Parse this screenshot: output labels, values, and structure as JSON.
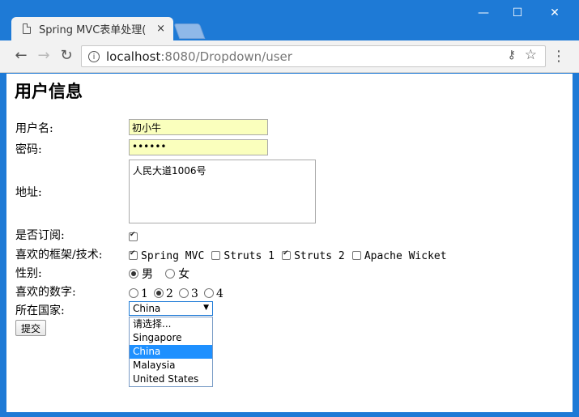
{
  "browser": {
    "tab_title": "Spring MVC表单处理(",
    "tab_close": "×",
    "url_host": "localhost",
    "url_path": ":8080/Dropdown/user",
    "win_minimize": "—",
    "win_maximize": "☐",
    "win_close": "✕"
  },
  "page": {
    "title": "用户信息",
    "username_label": "用户名:",
    "username_value": "初小牛",
    "password_label": "密码:",
    "password_value": "••••••",
    "address_label": "地址:",
    "address_value": "人民大道1006号",
    "subscribe_label": "是否订阅:",
    "subscribe_checked": true,
    "frameworks_label": "喜欢的框架/技术:",
    "frameworks": [
      {
        "label": "Spring MVC",
        "checked": true
      },
      {
        "label": "Struts 1",
        "checked": false
      },
      {
        "label": "Struts 2",
        "checked": true
      },
      {
        "label": "Apache Wicket",
        "checked": false
      }
    ],
    "gender_label": "性别:",
    "genders": [
      {
        "label": "男",
        "checked": true
      },
      {
        "label": "女",
        "checked": false
      }
    ],
    "number_label": "喜欢的数字:",
    "numbers": [
      {
        "label": "1",
        "checked": false
      },
      {
        "label": "2",
        "checked": true
      },
      {
        "label": "3",
        "checked": false
      },
      {
        "label": "4",
        "checked": false
      }
    ],
    "country_label": "所在国家:",
    "country_selected": "China",
    "country_options": [
      "请选择...",
      "Singapore",
      "China",
      "Malaysia",
      "United States"
    ],
    "submit_label": "提交"
  }
}
